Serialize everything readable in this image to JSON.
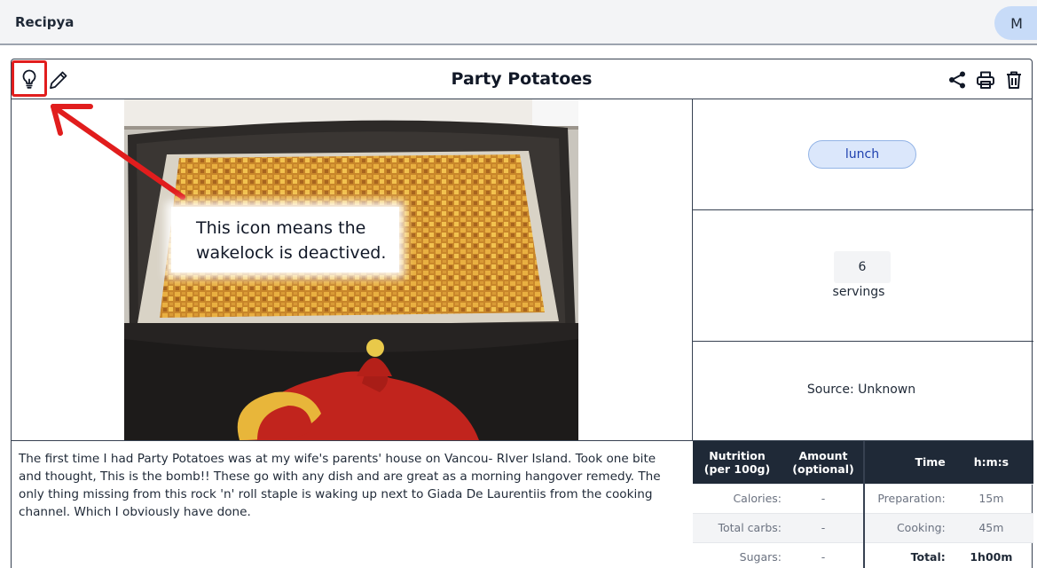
{
  "app": {
    "title": "Recipya",
    "avatar_initial": "M"
  },
  "recipe": {
    "title": "Party Potatoes",
    "category": "lunch",
    "servings_value": "6",
    "servings_label": "servings",
    "source": "Source: Unknown",
    "description": "The first time I had Party Potatoes was at my wife's parents' house on Vancou- RIver Island. Took one bite and thought, This is the bomb!! These go with any dish and are great as a morning hangover remedy. The only thing missing from this rock 'n' roll staple is waking up next to Giada De Laurentiis from the cooking channel. Which I obviously have done."
  },
  "toolbar_icons": [
    "lightbulb-icon",
    "pencil-icon",
    "share-icon",
    "printer-icon",
    "trash-icon"
  ],
  "annotation": {
    "text": "This icon means the wakelock is deactived.",
    "color": "#e11d1d"
  },
  "nutrition": {
    "header_col1": "Nutrition\n(per 100g)",
    "header_col2": "Amount\n(optional)",
    "rows": [
      {
        "label": "Calories:",
        "value": "-"
      },
      {
        "label": "Total carbs:",
        "value": "-"
      },
      {
        "label": "Sugars:",
        "value": "-"
      }
    ]
  },
  "times": {
    "header_col1": "Time",
    "header_col2": "h:m:s",
    "rows": [
      {
        "label": "Preparation:",
        "value": "15m"
      },
      {
        "label": "Cooking:",
        "value": "45m"
      },
      {
        "label": "Total:",
        "value": "1h00m"
      }
    ]
  },
  "colors": {
    "header_dark": "#1f2937",
    "tag_bg": "#dbe7fb",
    "avatar_bg": "#c7dbf8"
  }
}
